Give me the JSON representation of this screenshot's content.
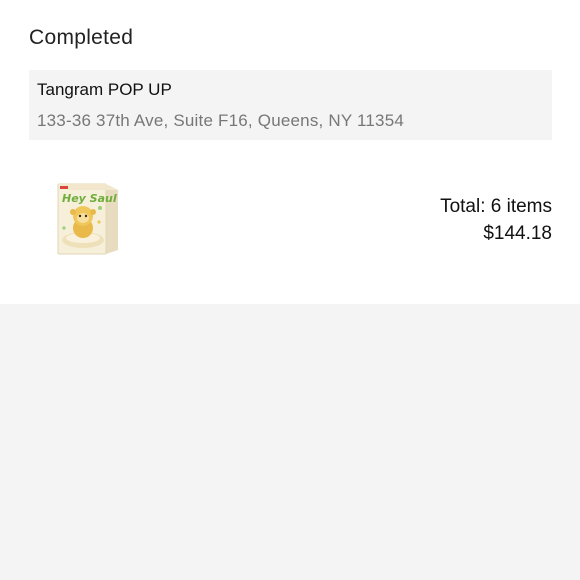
{
  "order": {
    "status": "Completed",
    "store": {
      "name": "Tangram POP UP",
      "address": "133-36 37th Ave, Suite F16, Queens, NY 11354"
    },
    "product": {
      "image_icon": "blind-box-figure-package",
      "box_text": "Hey Saul"
    },
    "summary": {
      "items_label": "Total: 6 items",
      "total": "$144.18"
    }
  },
  "colors": {
    "page_background": "#f4f4f4",
    "card_background": "#ffffff",
    "address_text": "#777777"
  }
}
